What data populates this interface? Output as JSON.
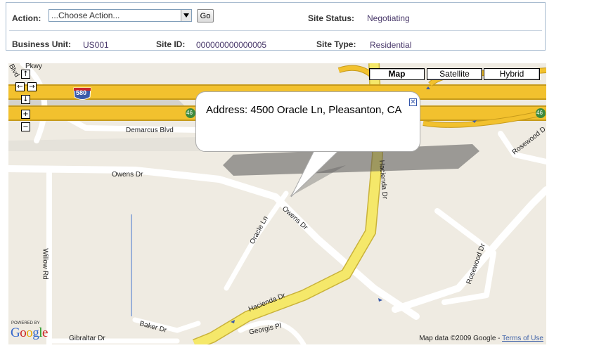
{
  "header": {
    "action_label": "Action:",
    "action_value": "...Choose Action...",
    "go_label": "Go",
    "site_status_label": "Site Status:",
    "site_status_value": "Negotiating",
    "business_unit_label": "Business Unit:",
    "business_unit_value": "US001",
    "site_id_label": "Site ID:",
    "site_id_value": "000000000000005",
    "site_type_label": "Site Type:",
    "site_type_value": "Residential"
  },
  "map": {
    "type_buttons": {
      "map": "Map",
      "satellite": "Satellite",
      "hybrid": "Hybrid"
    },
    "nav": {
      "up": "↑",
      "left": "←",
      "right": "→",
      "down": "↓",
      "zoom_in": "+",
      "zoom_out": "−"
    },
    "info_window": {
      "address": "Address: 4500 Oracle Ln, Pleasanton, CA"
    },
    "road_labels": {
      "demarcus": "Demarcus Blvd",
      "owens_w": "Owens Dr",
      "owens_e": "Owens Dr",
      "hacienda_n": "Hacienda Dr",
      "hacienda_s": "Hacienda Dr",
      "oracle": "Oracle Ln",
      "willow": "Willow Rd",
      "rosewood_s": "Rosewood Dr",
      "rosewood_n": "Rosewood D",
      "baker": "Baker Dr",
      "georgis": "Georgis Pl",
      "gibraltar": "Gibraltar Dr",
      "blvd_partial": "Blvd",
      "pkwy_partial": "Pkwy"
    },
    "shields": {
      "i580": "580",
      "sr46_w": "46",
      "sr46_e": "46"
    },
    "powered_by": "POWERED BY",
    "logo_letters": [
      "G",
      "o",
      "o",
      "g",
      "l",
      "e"
    ],
    "attribution": "Map data ©2009 Google - ",
    "terms_link": "Terms of Use",
    "colors": {
      "land": "#efebe2",
      "freeway": "#f2c12e",
      "freeway_edge": "#c69a1a",
      "major_road": "#f5e86a",
      "street": "#ffffff",
      "park_gray": "#d4d2cc",
      "shield_blue": "#3b5ba9",
      "shield_red": "#c8262e",
      "sr_green": "#3d8a3d"
    }
  }
}
